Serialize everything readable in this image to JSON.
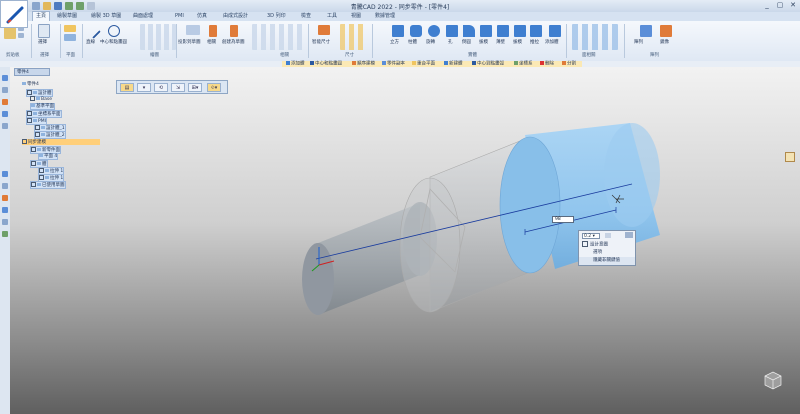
{
  "titlebar": {
    "title": "青騰CAD 2022 - 同步零件 - [零件4]",
    "window_controls": [
      "_",
      "▢",
      "✕"
    ]
  },
  "ribbon_tabs": [
    {
      "label": "主頁",
      "active": true
    },
    {
      "label": "繪製草圖",
      "active": false
    },
    {
      "label": "繪製 3D 草圖",
      "active": false
    },
    {
      "label": "曲面處理",
      "active": false
    },
    {
      "label": "PMI",
      "active": false
    },
    {
      "label": "仿真",
      "active": false
    },
    {
      "label": "由成式設計",
      "active": false
    },
    {
      "label": "3D 列印",
      "active": false
    },
    {
      "label": "檢查",
      "active": false
    },
    {
      "label": "工具",
      "active": false
    },
    {
      "label": "視圖",
      "active": false
    },
    {
      "label": "數據管理",
      "active": false
    }
  ],
  "ribbon": {
    "groups": [
      "剪貼板",
      "選擇",
      "平面",
      "繪圖",
      "相關",
      "尺寸",
      "實體",
      "修改",
      "面相關",
      "陣列"
    ],
    "buttons": {
      "select": "選擇",
      "line": "直線",
      "center_circle": "中心和點畫圓",
      "projection": "投影到草圖",
      "mirror": "相關",
      "create_to_sketch": "創建為草圖",
      "smart_dimension": "智能尺寸",
      "extrude": "拉伸",
      "revolve": "旋轉",
      "hole": "孔",
      "round": "倒圓",
      "chamfer": "拔模",
      "thin": "薄壁",
      "draft": "拔模",
      "add_body": "添加體",
      "pattern": "陣列",
      "mirror2": "鏡像",
      "cube": "立方",
      "column": "柱體",
      "pull": "推拉"
    }
  },
  "command_bar": {
    "items": [
      "添加體",
      "中心和點畫圓",
      "順序建模",
      "零件副本",
      "重合平面",
      "新建體",
      "中心到點畫弧",
      "坐標系",
      "刪除",
      "分割"
    ]
  },
  "document_tab": "零件4",
  "tree": [
    {
      "label": "零件4",
      "level": 0,
      "checked": false,
      "selected": false
    },
    {
      "label": "設計體",
      "level": 1,
      "checked": true,
      "selected": false
    },
    {
      "label": "Base",
      "level": 2,
      "checked": true,
      "selected": false
    },
    {
      "label": "基準平面",
      "level": 2,
      "checked": false,
      "selected": false
    },
    {
      "label": "坐標系平面",
      "level": 1,
      "checked": false,
      "selected": false
    },
    {
      "label": "PMI",
      "level": 1,
      "checked": true,
      "selected": false
    },
    {
      "label": "設計體_1",
      "level": 2,
      "checked": true,
      "selected": false
    },
    {
      "label": "設計體_2",
      "level": 2,
      "checked": true,
      "selected": false
    },
    {
      "label": "同步建模",
      "level": 0,
      "checked": false,
      "selected": true
    },
    {
      "label": "新零件面",
      "level": 1,
      "checked": true,
      "selected": false
    },
    {
      "label": "平面 4",
      "level": 2,
      "checked": false,
      "selected": false
    },
    {
      "label": "體",
      "level": 1,
      "checked": false,
      "selected": false
    },
    {
      "label": "拉伸 1",
      "level": 2,
      "checked": true,
      "selected": false
    },
    {
      "label": "拉伸 1",
      "level": 2,
      "checked": true,
      "selected": false
    },
    {
      "label": "已使用草圖",
      "level": 1,
      "checked": true,
      "selected": false
    }
  ],
  "floating_toolbar": [
    "▤",
    "▾",
    "⟲",
    "⇲",
    "⊞▾",
    "⟐▾"
  ],
  "dimension_value": "98",
  "context_panel": {
    "dropdown": "0.2",
    "checkbox_label": "設計意圖",
    "option": "選項",
    "bottom": "隱藏非關鍵值"
  },
  "colors": {
    "cylinder_selected": "#8ec5ef",
    "cylinder_body": "#c9c9c9",
    "dimension_line": "#1a3c9e",
    "tree_selection": "#ffcf7a"
  }
}
